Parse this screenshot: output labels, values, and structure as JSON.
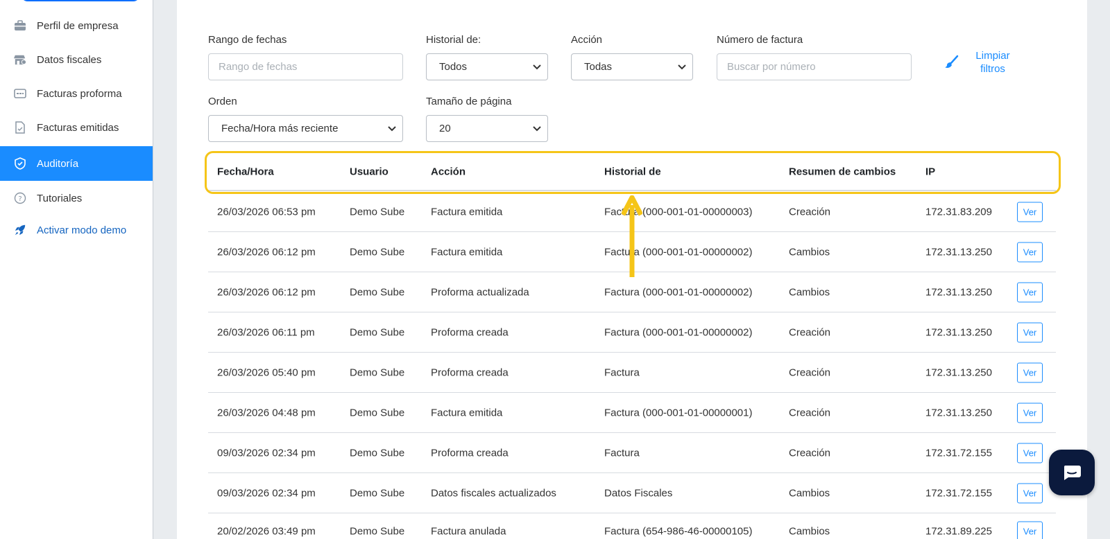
{
  "sidebar": {
    "items": [
      {
        "label": "Perfil de empresa",
        "icon": "briefcase-icon"
      },
      {
        "label": "Datos fiscales",
        "icon": "store-icon"
      },
      {
        "label": "Facturas proforma",
        "icon": "card-icon"
      },
      {
        "label": "Facturas emitidas",
        "icon": "document-icon"
      },
      {
        "label": "Auditoría",
        "icon": "shield-icon",
        "active": true
      },
      {
        "label": "Tutoriales",
        "icon": "help-icon"
      },
      {
        "label": "Activar modo demo",
        "icon": "rocket-icon"
      }
    ]
  },
  "filters": {
    "date_range_label": "Rango de fechas",
    "date_range_placeholder": "Rango de fechas",
    "history_label": "Historial de:",
    "history_value": "Todos",
    "action_label": "Acción",
    "action_value": "Todas",
    "invoice_label": "Número de factura",
    "invoice_placeholder": "Buscar por número",
    "clear_label_1": "Limpiar",
    "clear_label_2": "filtros",
    "order_label": "Orden",
    "order_value": "Fecha/Hora más reciente",
    "page_size_label": "Tamaño de página",
    "page_size_value": "20"
  },
  "table": {
    "headers": [
      "Fecha/Hora",
      "Usuario",
      "Acción",
      "Historial de",
      "Resumen de cambios",
      "IP"
    ],
    "view_label": "Ver",
    "rows": [
      [
        "26/03/2026 06:53 pm",
        "Demo Sube",
        "Factura emitida",
        "Factura (000-001-01-00000003)",
        "Creación",
        "172.31.83.209"
      ],
      [
        "26/03/2026 06:12 pm",
        "Demo Sube",
        "Factura emitida",
        "Factura (000-001-01-00000002)",
        "Cambios",
        "172.31.13.250"
      ],
      [
        "26/03/2026 06:12 pm",
        "Demo Sube",
        "Proforma actualizada",
        "Factura (000-001-01-00000002)",
        "Cambios",
        "172.31.13.250"
      ],
      [
        "26/03/2026 06:11 pm",
        "Demo Sube",
        "Proforma creada",
        "Factura (000-001-01-00000002)",
        "Creación",
        "172.31.13.250"
      ],
      [
        "26/03/2026 05:40 pm",
        "Demo Sube",
        "Proforma creada",
        "Factura",
        "Creación",
        "172.31.13.250"
      ],
      [
        "26/03/2026 04:48 pm",
        "Demo Sube",
        "Factura emitida",
        "Factura (000-001-01-00000001)",
        "Creación",
        "172.31.13.250"
      ],
      [
        "09/03/2026 02:34 pm",
        "Demo Sube",
        "Proforma creada",
        "Factura",
        "Creación",
        "172.31.72.155"
      ],
      [
        "09/03/2026 02:34 pm",
        "Demo Sube",
        "Datos fiscales actualizados",
        "Datos Fiscales",
        "Cambios",
        "172.31.72.155"
      ],
      [
        "20/02/2026 03:49 pm",
        "Demo Sube",
        "Factura anulada",
        "Factura (654-986-46-00000105)",
        "Cambios",
        "172.31.89.225"
      ]
    ]
  },
  "colors": {
    "accent": "#1a8cff",
    "highlight": "#f5c518",
    "chat": "#0b1a3d"
  }
}
